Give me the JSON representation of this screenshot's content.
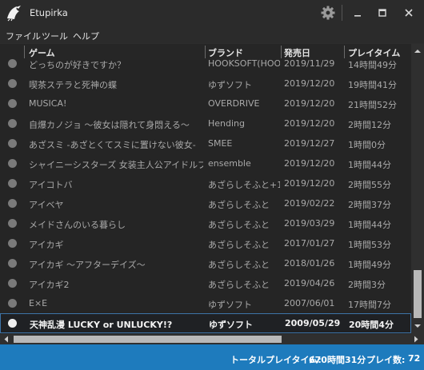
{
  "app": {
    "title": "Etupirka"
  },
  "menu": [
    "ファイル",
    "ツール",
    "ヘルプ"
  ],
  "columns": {
    "game": "ゲーム",
    "brand": "ブランド",
    "date": "発売日",
    "playtime": "プレイタイム"
  },
  "rows": [
    {
      "game": "どっちのが好きですか？",
      "brand": "HOOKSOFT(HOO",
      "date": "2019/11/29",
      "playtime": "14時間49分"
    },
    {
      "game": "喫茶ステラと死神の蝶",
      "brand": "ゆずソフト",
      "date": "2019/12/20",
      "playtime": "19時間41分"
    },
    {
      "game": "MUSICA!",
      "brand": "OVERDRIVE",
      "date": "2019/12/20",
      "playtime": "21時間52分"
    },
    {
      "game": "自爆カノジョ ～彼女は隠れて身悶える～",
      "brand": "Hending",
      "date": "2019/12/20",
      "playtime": "2時間12分"
    },
    {
      "game": "あざスミ -あざとくてスミに置けない彼女-",
      "brand": "SMEE",
      "date": "2019/12/27",
      "playtime": "1時間0分"
    },
    {
      "game": "シャイニーシスターズ 女装主人公アイドルプロジェクト",
      "brand": "ensemble",
      "date": "2019/12/20",
      "playtime": "1時間44分"
    },
    {
      "game": "アイコトバ",
      "brand": "あざらしそふと+1",
      "date": "2019/12/20",
      "playtime": "2時間55分"
    },
    {
      "game": "アイベヤ",
      "brand": "あざらしそふと",
      "date": "2019/02/22",
      "playtime": "2時間37分"
    },
    {
      "game": "メイドさんのいる暮らし",
      "brand": "あざらしそふと",
      "date": "2019/03/29",
      "playtime": "1時間44分"
    },
    {
      "game": "アイカギ",
      "brand": "あざらしそふと",
      "date": "2017/01/27",
      "playtime": "1時間53分"
    },
    {
      "game": "アイカギ ～アフターデイズ～",
      "brand": "あざらしそふと",
      "date": "2018/01/26",
      "playtime": "1時間49分"
    },
    {
      "game": "アイカギ2",
      "brand": "あざらしそふと",
      "date": "2019/04/26",
      "playtime": "2時間3分"
    },
    {
      "game": "E×E",
      "brand": "ゆずソフト",
      "date": "2007/06/01",
      "playtime": "17時間7分"
    },
    {
      "game": "天神乱漫 LUCKY or UNLUCKY!?",
      "brand": "ゆずソフト",
      "date": "2009/05/29",
      "playtime": "20時間4分",
      "selected": true
    }
  ],
  "status": {
    "total_label": "トータルプレイタイム:",
    "total_value": "670時間31分",
    "count_label": "プレイ数:",
    "count_value": "72"
  },
  "colors": {
    "accent": "#1e7bbd",
    "selection_border": "#3d74a8",
    "background": "#252525"
  },
  "icons": [
    "app-logo-icon",
    "gear-icon",
    "minimize-icon",
    "maximize-icon",
    "close-icon"
  ]
}
